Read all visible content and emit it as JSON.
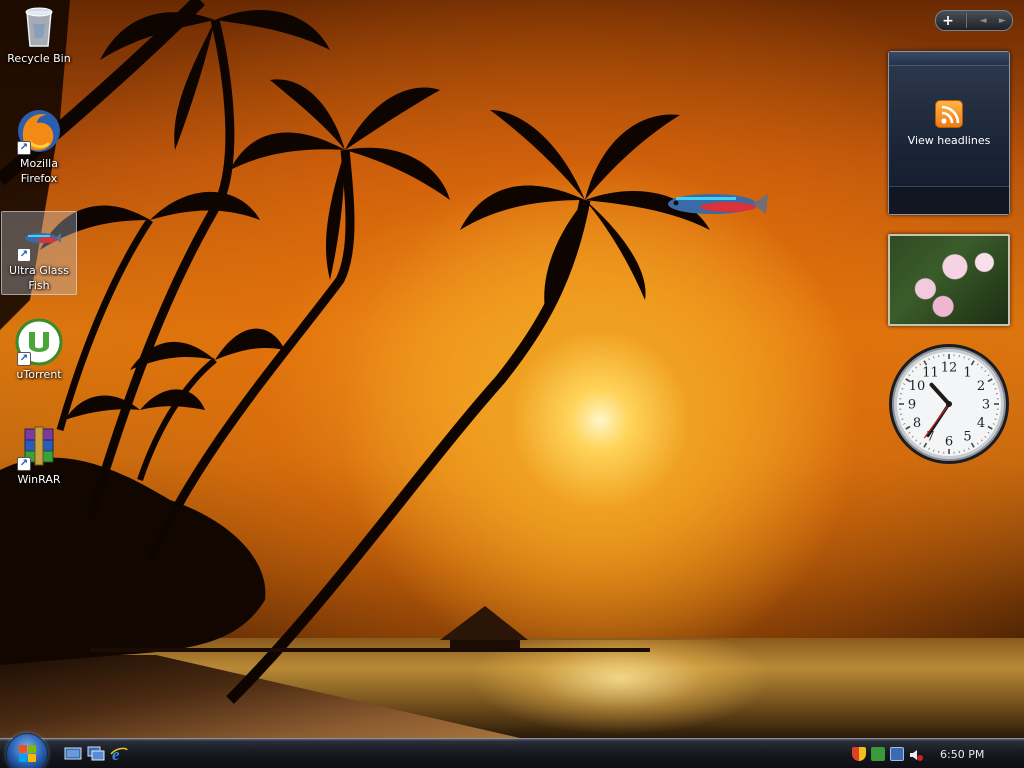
{
  "desktop": {
    "icons": [
      {
        "label": "Recycle Bin",
        "icon": "recycle-bin-icon",
        "shortcut": false,
        "selected": false
      },
      {
        "label": "Mozilla Firefox",
        "icon": "firefox-icon",
        "shortcut": true,
        "selected": false
      },
      {
        "label": "Ultra Glass Fish",
        "icon": "fish-icon",
        "shortcut": true,
        "selected": true
      },
      {
        "label": "uTorrent",
        "icon": "utorrent-icon",
        "shortcut": true,
        "selected": false
      },
      {
        "label": "WinRAR",
        "icon": "winrar-icon",
        "shortcut": true,
        "selected": false
      }
    ]
  },
  "sidebar": {
    "controls": {
      "add": "+",
      "prev": "◄",
      "next": "►"
    },
    "feed_gadget": {
      "label": "View headlines",
      "icon": "rss-icon"
    },
    "slideshow_gadget": {
      "icon": "photo-slideshow-icon"
    },
    "clock_gadget": {
      "hour": 10,
      "minute": 35,
      "second": 36,
      "numerals": [
        "12",
        "1",
        "2",
        "3",
        "4",
        "5",
        "6",
        "7",
        "8",
        "9",
        "10",
        "11"
      ]
    }
  },
  "taskbar": {
    "start": {
      "icon": "windows-start-orb"
    },
    "quick_launch": [
      {
        "icon": "show-desktop-icon"
      },
      {
        "icon": "switch-windows-icon"
      },
      {
        "icon": "internet-explorer-icon"
      }
    ],
    "tray_icons": [
      "security-shield-icon",
      "update-icon",
      "network-icon",
      "volume-muted-icon"
    ],
    "time": "6:50 PM"
  },
  "colors": {
    "accent": "#2d67b8",
    "rss": "#f07a10",
    "desktop_sky": "#d9780f"
  }
}
